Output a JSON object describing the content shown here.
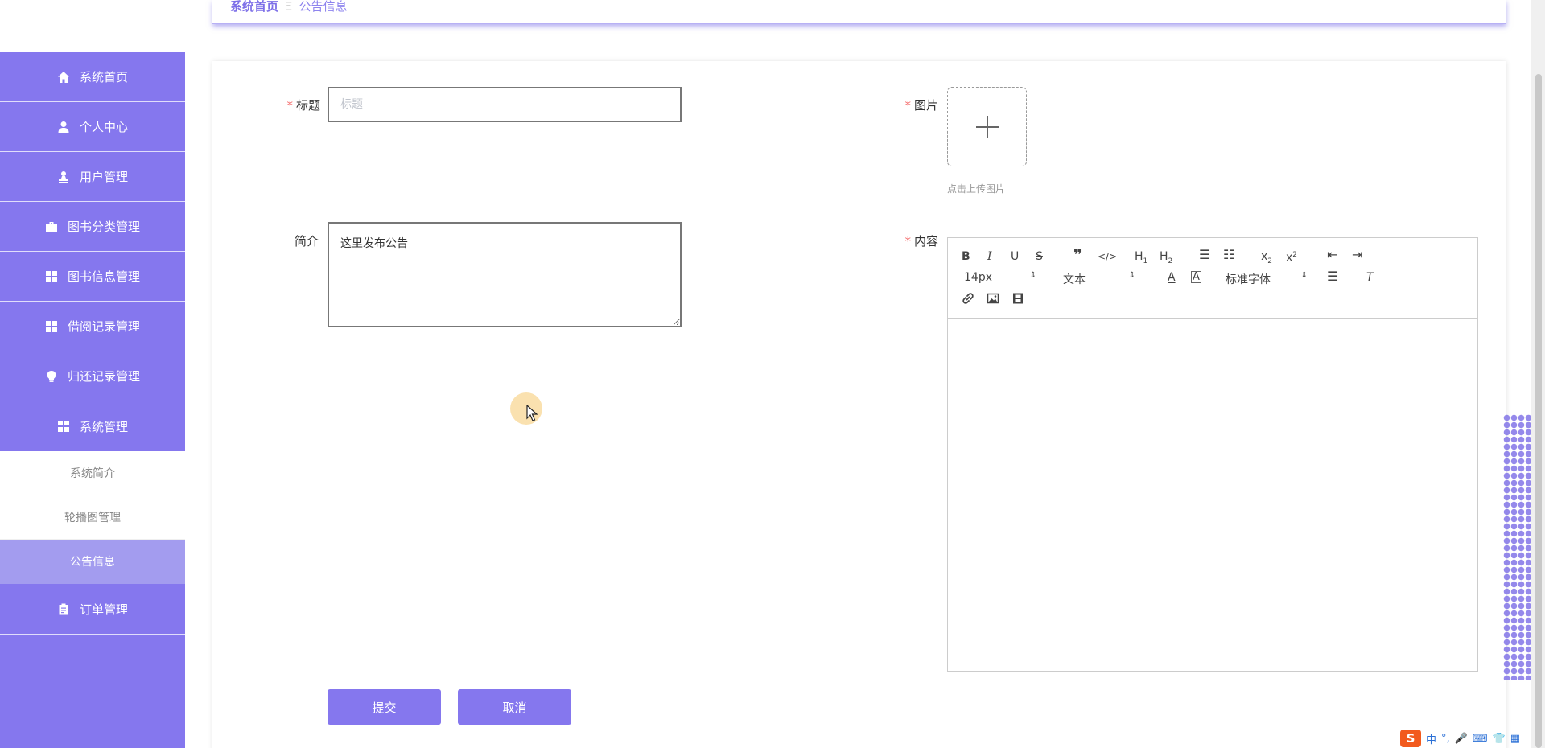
{
  "breadcrumb": {
    "home": "系统首页",
    "separator": "Ξ",
    "current": "公告信息"
  },
  "sidebar": {
    "items": [
      {
        "label": "系统首页",
        "icon": "home-icon"
      },
      {
        "label": "个人中心",
        "icon": "user-icon"
      },
      {
        "label": "用户管理",
        "icon": "user-stamp-icon"
      },
      {
        "label": "图书分类管理",
        "icon": "briefcase-icon"
      },
      {
        "label": "图书信息管理",
        "icon": "grid-icon"
      },
      {
        "label": "借阅记录管理",
        "icon": "grid-icon"
      },
      {
        "label": "归还记录管理",
        "icon": "lightbulb-icon"
      },
      {
        "label": "系统管理",
        "icon": "grid-icon"
      }
    ],
    "sub_items": [
      {
        "label": "系统简介",
        "active": false
      },
      {
        "label": "轮播图管理",
        "active": false
      },
      {
        "label": "公告信息",
        "active": true
      }
    ],
    "after_items": [
      {
        "label": "订单管理",
        "icon": "clipboard-icon"
      }
    ]
  },
  "form": {
    "title_label": "标题",
    "title_placeholder": "标题",
    "title_value": "",
    "intro_label": "简介",
    "intro_value": "这里发布公告",
    "image_label": "图片",
    "upload_tip": "点击上传图片",
    "content_label": "内容",
    "required_mark": "*"
  },
  "editor": {
    "font_size": "14px",
    "header_select": "文本",
    "font_family": "标准字体",
    "tools": [
      "bold",
      "italic",
      "underline",
      "strike",
      "blockquote",
      "code-block",
      "h1",
      "h2",
      "ordered-list",
      "bullet-list",
      "subscript",
      "superscript",
      "outdent",
      "indent",
      "font-color",
      "background-color",
      "align",
      "clean",
      "link",
      "image",
      "video"
    ]
  },
  "buttons": {
    "submit": "提交",
    "cancel": "取消"
  },
  "ime": {
    "logo": "S",
    "mode": "中"
  },
  "colors": {
    "accent": "#8577ee",
    "active_sub": "#a39cef",
    "required": "#f56c6c"
  }
}
